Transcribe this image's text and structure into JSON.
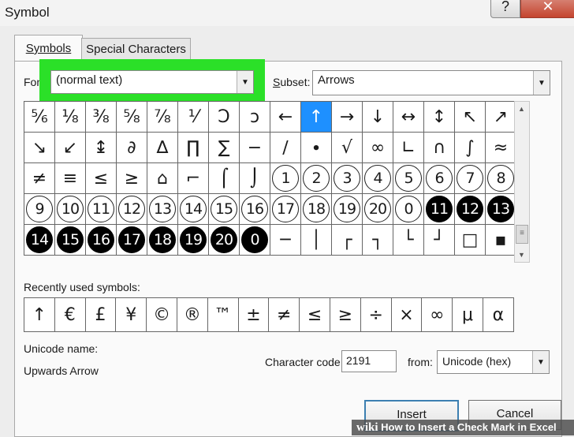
{
  "window": {
    "title": "Symbol",
    "help_label": "?",
    "close_label": "✕"
  },
  "tabs": [
    {
      "label": "Symbols",
      "active": true
    },
    {
      "label": "Special Characters",
      "active": false
    }
  ],
  "font": {
    "label": "Font:",
    "value": "(normal text)"
  },
  "subset": {
    "label": "Subset:",
    "value": "Arrows"
  },
  "symbol_grid": {
    "selected": "↑",
    "rows": [
      [
        "⅚",
        "⅛",
        "⅜",
        "⅝",
        "⅞",
        "⅟",
        "Ↄ",
        "ↄ",
        "←",
        "↑",
        "→",
        "↓",
        "↔",
        "↕",
        "↖",
        "↗"
      ],
      [
        "↘",
        "↙",
        "↨",
        "∂",
        "∆",
        "∏",
        "∑",
        "−",
        "∕",
        "∙",
        "√",
        "∞",
        "∟",
        "∩",
        "∫",
        "≈"
      ],
      [
        "≠",
        "≡",
        "≤",
        "≥",
        "⌂",
        "⌐",
        "⌠",
        "⌡",
        "①",
        "②",
        "③",
        "④",
        "⑤",
        "⑥",
        "⑦",
        "⑧"
      ],
      [
        "⑨",
        "⑩",
        "⑪",
        "⑫",
        "⑬",
        "⑭",
        "⑮",
        "⑯",
        "⑰",
        "⑱",
        "⑲",
        "⑳",
        "⓪",
        "⓫",
        "⓬",
        "⓭"
      ],
      [
        "⓮",
        "⓯",
        "⓰",
        "⓱",
        "⓲",
        "⓳",
        "⓴",
        "⓿",
        "─",
        "│",
        "┌",
        "┐",
        "└",
        "┘",
        "□",
        "▪"
      ]
    ]
  },
  "recent": {
    "label": "Recently used symbols:",
    "symbols": [
      "↑",
      "€",
      "£",
      "¥",
      "©",
      "®",
      "™",
      "±",
      "≠",
      "≤",
      "≥",
      "÷",
      "×",
      "∞",
      "μ",
      "α"
    ]
  },
  "unicode_name": {
    "label": "Unicode name:",
    "value": "Upwards Arrow"
  },
  "character_code": {
    "label": "Character code:",
    "value": "2191"
  },
  "from": {
    "label": "from:",
    "value": "Unicode (hex)"
  },
  "buttons": {
    "insert": "Insert",
    "cancel": "Cancel"
  },
  "watermark": {
    "brand": "wiki",
    "text": "How to Insert a Check Mark in Excel"
  },
  "colors": {
    "highlight": "#2be028",
    "selection": "#1e90ff"
  }
}
